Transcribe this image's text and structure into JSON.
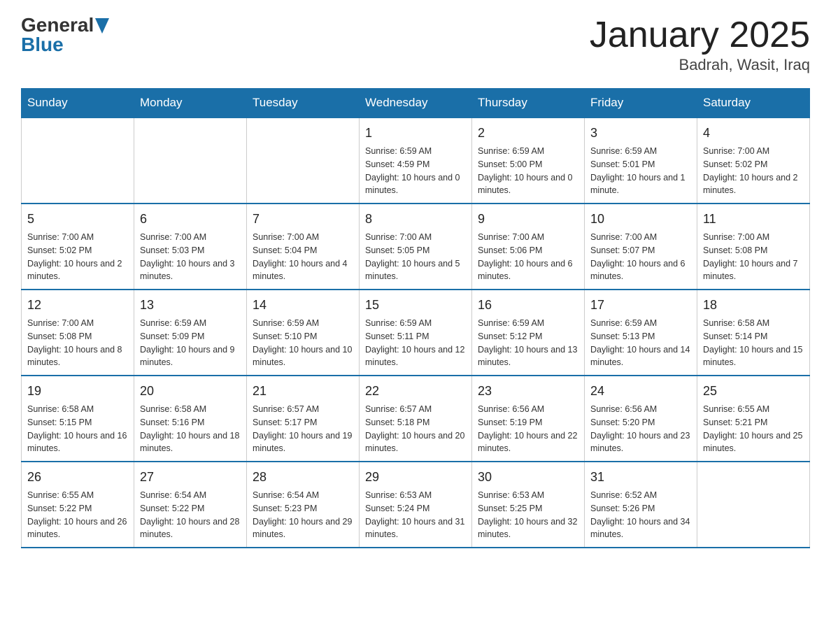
{
  "header": {
    "logo_general": "General",
    "logo_blue": "Blue",
    "title": "January 2025",
    "subtitle": "Badrah, Wasit, Iraq"
  },
  "days_of_week": [
    "Sunday",
    "Monday",
    "Tuesday",
    "Wednesday",
    "Thursday",
    "Friday",
    "Saturday"
  ],
  "weeks": [
    [
      {
        "day": "",
        "sunrise": "",
        "sunset": "",
        "daylight": ""
      },
      {
        "day": "",
        "sunrise": "",
        "sunset": "",
        "daylight": ""
      },
      {
        "day": "",
        "sunrise": "",
        "sunset": "",
        "daylight": ""
      },
      {
        "day": "1",
        "sunrise": "Sunrise: 6:59 AM",
        "sunset": "Sunset: 4:59 PM",
        "daylight": "Daylight: 10 hours and 0 minutes."
      },
      {
        "day": "2",
        "sunrise": "Sunrise: 6:59 AM",
        "sunset": "Sunset: 5:00 PM",
        "daylight": "Daylight: 10 hours and 0 minutes."
      },
      {
        "day": "3",
        "sunrise": "Sunrise: 6:59 AM",
        "sunset": "Sunset: 5:01 PM",
        "daylight": "Daylight: 10 hours and 1 minute."
      },
      {
        "day": "4",
        "sunrise": "Sunrise: 7:00 AM",
        "sunset": "Sunset: 5:02 PM",
        "daylight": "Daylight: 10 hours and 2 minutes."
      }
    ],
    [
      {
        "day": "5",
        "sunrise": "Sunrise: 7:00 AM",
        "sunset": "Sunset: 5:02 PM",
        "daylight": "Daylight: 10 hours and 2 minutes."
      },
      {
        "day": "6",
        "sunrise": "Sunrise: 7:00 AM",
        "sunset": "Sunset: 5:03 PM",
        "daylight": "Daylight: 10 hours and 3 minutes."
      },
      {
        "day": "7",
        "sunrise": "Sunrise: 7:00 AM",
        "sunset": "Sunset: 5:04 PM",
        "daylight": "Daylight: 10 hours and 4 minutes."
      },
      {
        "day": "8",
        "sunrise": "Sunrise: 7:00 AM",
        "sunset": "Sunset: 5:05 PM",
        "daylight": "Daylight: 10 hours and 5 minutes."
      },
      {
        "day": "9",
        "sunrise": "Sunrise: 7:00 AM",
        "sunset": "Sunset: 5:06 PM",
        "daylight": "Daylight: 10 hours and 6 minutes."
      },
      {
        "day": "10",
        "sunrise": "Sunrise: 7:00 AM",
        "sunset": "Sunset: 5:07 PM",
        "daylight": "Daylight: 10 hours and 6 minutes."
      },
      {
        "day": "11",
        "sunrise": "Sunrise: 7:00 AM",
        "sunset": "Sunset: 5:08 PM",
        "daylight": "Daylight: 10 hours and 7 minutes."
      }
    ],
    [
      {
        "day": "12",
        "sunrise": "Sunrise: 7:00 AM",
        "sunset": "Sunset: 5:08 PM",
        "daylight": "Daylight: 10 hours and 8 minutes."
      },
      {
        "day": "13",
        "sunrise": "Sunrise: 6:59 AM",
        "sunset": "Sunset: 5:09 PM",
        "daylight": "Daylight: 10 hours and 9 minutes."
      },
      {
        "day": "14",
        "sunrise": "Sunrise: 6:59 AM",
        "sunset": "Sunset: 5:10 PM",
        "daylight": "Daylight: 10 hours and 10 minutes."
      },
      {
        "day": "15",
        "sunrise": "Sunrise: 6:59 AM",
        "sunset": "Sunset: 5:11 PM",
        "daylight": "Daylight: 10 hours and 12 minutes."
      },
      {
        "day": "16",
        "sunrise": "Sunrise: 6:59 AM",
        "sunset": "Sunset: 5:12 PM",
        "daylight": "Daylight: 10 hours and 13 minutes."
      },
      {
        "day": "17",
        "sunrise": "Sunrise: 6:59 AM",
        "sunset": "Sunset: 5:13 PM",
        "daylight": "Daylight: 10 hours and 14 minutes."
      },
      {
        "day": "18",
        "sunrise": "Sunrise: 6:58 AM",
        "sunset": "Sunset: 5:14 PM",
        "daylight": "Daylight: 10 hours and 15 minutes."
      }
    ],
    [
      {
        "day": "19",
        "sunrise": "Sunrise: 6:58 AM",
        "sunset": "Sunset: 5:15 PM",
        "daylight": "Daylight: 10 hours and 16 minutes."
      },
      {
        "day": "20",
        "sunrise": "Sunrise: 6:58 AM",
        "sunset": "Sunset: 5:16 PM",
        "daylight": "Daylight: 10 hours and 18 minutes."
      },
      {
        "day": "21",
        "sunrise": "Sunrise: 6:57 AM",
        "sunset": "Sunset: 5:17 PM",
        "daylight": "Daylight: 10 hours and 19 minutes."
      },
      {
        "day": "22",
        "sunrise": "Sunrise: 6:57 AM",
        "sunset": "Sunset: 5:18 PM",
        "daylight": "Daylight: 10 hours and 20 minutes."
      },
      {
        "day": "23",
        "sunrise": "Sunrise: 6:56 AM",
        "sunset": "Sunset: 5:19 PM",
        "daylight": "Daylight: 10 hours and 22 minutes."
      },
      {
        "day": "24",
        "sunrise": "Sunrise: 6:56 AM",
        "sunset": "Sunset: 5:20 PM",
        "daylight": "Daylight: 10 hours and 23 minutes."
      },
      {
        "day": "25",
        "sunrise": "Sunrise: 6:55 AM",
        "sunset": "Sunset: 5:21 PM",
        "daylight": "Daylight: 10 hours and 25 minutes."
      }
    ],
    [
      {
        "day": "26",
        "sunrise": "Sunrise: 6:55 AM",
        "sunset": "Sunset: 5:22 PM",
        "daylight": "Daylight: 10 hours and 26 minutes."
      },
      {
        "day": "27",
        "sunrise": "Sunrise: 6:54 AM",
        "sunset": "Sunset: 5:22 PM",
        "daylight": "Daylight: 10 hours and 28 minutes."
      },
      {
        "day": "28",
        "sunrise": "Sunrise: 6:54 AM",
        "sunset": "Sunset: 5:23 PM",
        "daylight": "Daylight: 10 hours and 29 minutes."
      },
      {
        "day": "29",
        "sunrise": "Sunrise: 6:53 AM",
        "sunset": "Sunset: 5:24 PM",
        "daylight": "Daylight: 10 hours and 31 minutes."
      },
      {
        "day": "30",
        "sunrise": "Sunrise: 6:53 AM",
        "sunset": "Sunset: 5:25 PM",
        "daylight": "Daylight: 10 hours and 32 minutes."
      },
      {
        "day": "31",
        "sunrise": "Sunrise: 6:52 AM",
        "sunset": "Sunset: 5:26 PM",
        "daylight": "Daylight: 10 hours and 34 minutes."
      },
      {
        "day": "",
        "sunrise": "",
        "sunset": "",
        "daylight": ""
      }
    ]
  ]
}
